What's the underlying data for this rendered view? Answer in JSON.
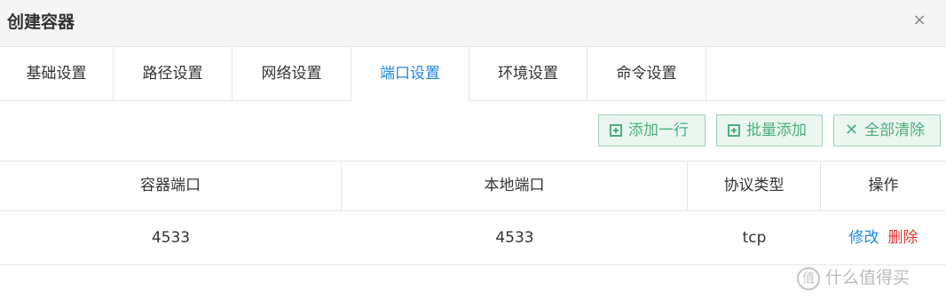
{
  "dialog": {
    "title": "创建容器",
    "close_icon": "×"
  },
  "tabs": [
    {
      "label": "基础设置"
    },
    {
      "label": "路径设置"
    },
    {
      "label": "网络设置"
    },
    {
      "label": "端口设置",
      "active": true
    },
    {
      "label": "环境设置"
    },
    {
      "label": "命令设置"
    }
  ],
  "toolbar": {
    "add_row_label": "添加一行",
    "batch_add_label": "批量添加",
    "clear_all_label": "全部清除"
  },
  "table": {
    "headers": [
      "容器端口",
      "本地端口",
      "协议类型",
      "操作"
    ],
    "rows": [
      {
        "container_port": "4533",
        "local_port": "4533",
        "protocol": "tcp",
        "edit_label": "修改",
        "delete_label": "删除"
      }
    ]
  },
  "watermark": {
    "text": "什么值得买",
    "logo_char": "值"
  },
  "colors": {
    "active_tab": "#1e88e5",
    "button_green": "#4caf7d",
    "delete_red": "#e53935"
  }
}
